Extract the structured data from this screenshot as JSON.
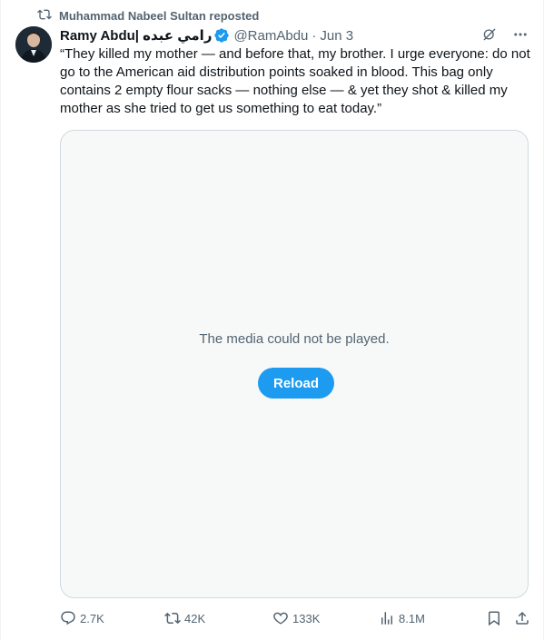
{
  "repost": {
    "text": "Muhammad Nabeel Sultan reposted",
    "icon": "repost-icon"
  },
  "author": {
    "name": "Ramy Abdu| رامي عبده",
    "handle": "@RamAbdu",
    "separator": "·",
    "date": "Jun 3",
    "verified_color": "#1d9bf0"
  },
  "tweet": {
    "text": "“They killed my mother — and before that, my brother. I urge everyone: do not go to the American aid distribution points soaked in blood. This bag only contains 2 empty flour sacks — nothing else — & yet they shot & killed my mother as she tried to get us something to eat today.”"
  },
  "media": {
    "message": "The media could not be played.",
    "reload_label": "Reload"
  },
  "actions": {
    "replies": "2.7K",
    "reposts": "42K",
    "likes": "133K",
    "views": "8.1M"
  },
  "colors": {
    "accent": "#1d9bf0",
    "muted_text": "#536471",
    "media_bg": "#f7f9f9"
  }
}
